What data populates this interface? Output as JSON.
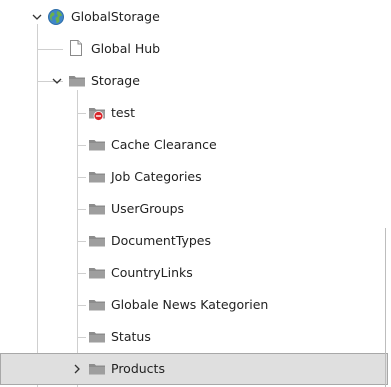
{
  "tree": {
    "root": {
      "label": "GlobalStorage",
      "icon": "globe-icon",
      "expanded": true
    },
    "items": [
      {
        "label": "Global Hub",
        "icon": "page-icon"
      },
      {
        "label": "Storage",
        "icon": "folder-icon",
        "expanded": true
      },
      {
        "label": "test",
        "icon": "folder-restricted-icon"
      },
      {
        "label": "Cache Clearance",
        "icon": "folder-icon"
      },
      {
        "label": "Job Categories",
        "icon": "folder-icon"
      },
      {
        "label": "UserGroups",
        "icon": "folder-icon"
      },
      {
        "label": "DocumentTypes",
        "icon": "folder-icon"
      },
      {
        "label": "CountryLinks",
        "icon": "folder-icon"
      },
      {
        "label": "Globale News Kategorien",
        "icon": "folder-icon"
      },
      {
        "label": "Status",
        "icon": "folder-icon"
      },
      {
        "label": "Products",
        "icon": "folder-icon",
        "expanded": false,
        "selected": true
      }
    ]
  },
  "colors": {
    "guide_line": "#cfcfcf",
    "folder": "#8c8c8c",
    "selected_row": "#dfdfdf",
    "restricted_badge": "#d9262b"
  }
}
